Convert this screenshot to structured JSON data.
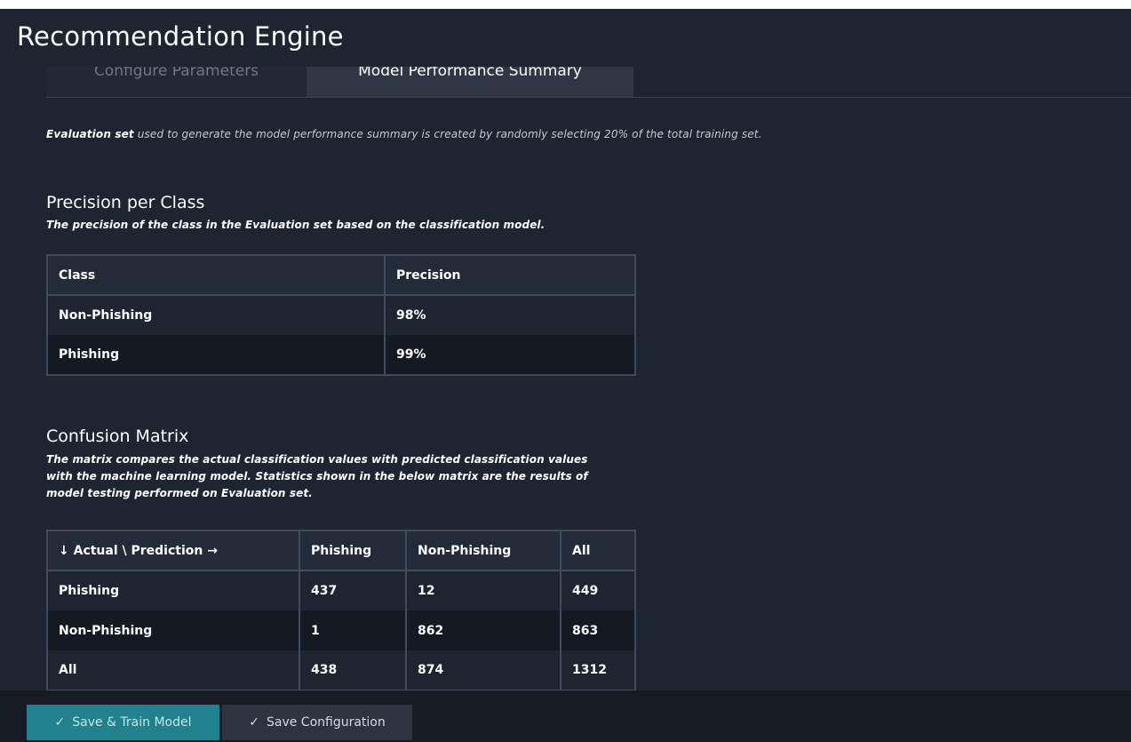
{
  "app": {
    "title": "Recommendation Engine"
  },
  "tabs": [
    {
      "label": "Configure Parameters"
    },
    {
      "label": "Model Performance Summary"
    }
  ],
  "intro": {
    "bold": "Evaluation set",
    "text": " used to generate the model performance summary is created by randomly selecting 20% of the total training set."
  },
  "precision": {
    "title": "Precision per Class",
    "description": "The precision of the class in the Evaluation set based on the classification model.",
    "headers": [
      "Class",
      "Precision"
    ],
    "rows": [
      [
        "Non-Phishing",
        "98%"
      ],
      [
        "Phishing",
        "99%"
      ]
    ]
  },
  "confusion": {
    "title": "Confusion Matrix",
    "description_lines": [
      "The matrix compares the actual classification values with predicted classification values",
      "with the machine learning model. Statistics shown in the below matrix are the results of",
      "model testing performed on Evaluation set."
    ],
    "headers": [
      "↓ Actual \\ Prediction →",
      "Phishing",
      "Non-Phishing",
      "All"
    ],
    "rows": [
      [
        "Phishing",
        "437",
        "12",
        "449"
      ],
      [
        "Non-Phishing",
        "1",
        "862",
        "863"
      ],
      [
        "All",
        "438",
        "874",
        "1312"
      ]
    ]
  },
  "footer": {
    "save_train_label": "Save & Train Model",
    "save_config_label": "Save Configuration",
    "check_icon": "✓"
  },
  "colors": {
    "background": "#1e2430",
    "accent": "#21818c",
    "table_border": "#3f4c5c"
  }
}
